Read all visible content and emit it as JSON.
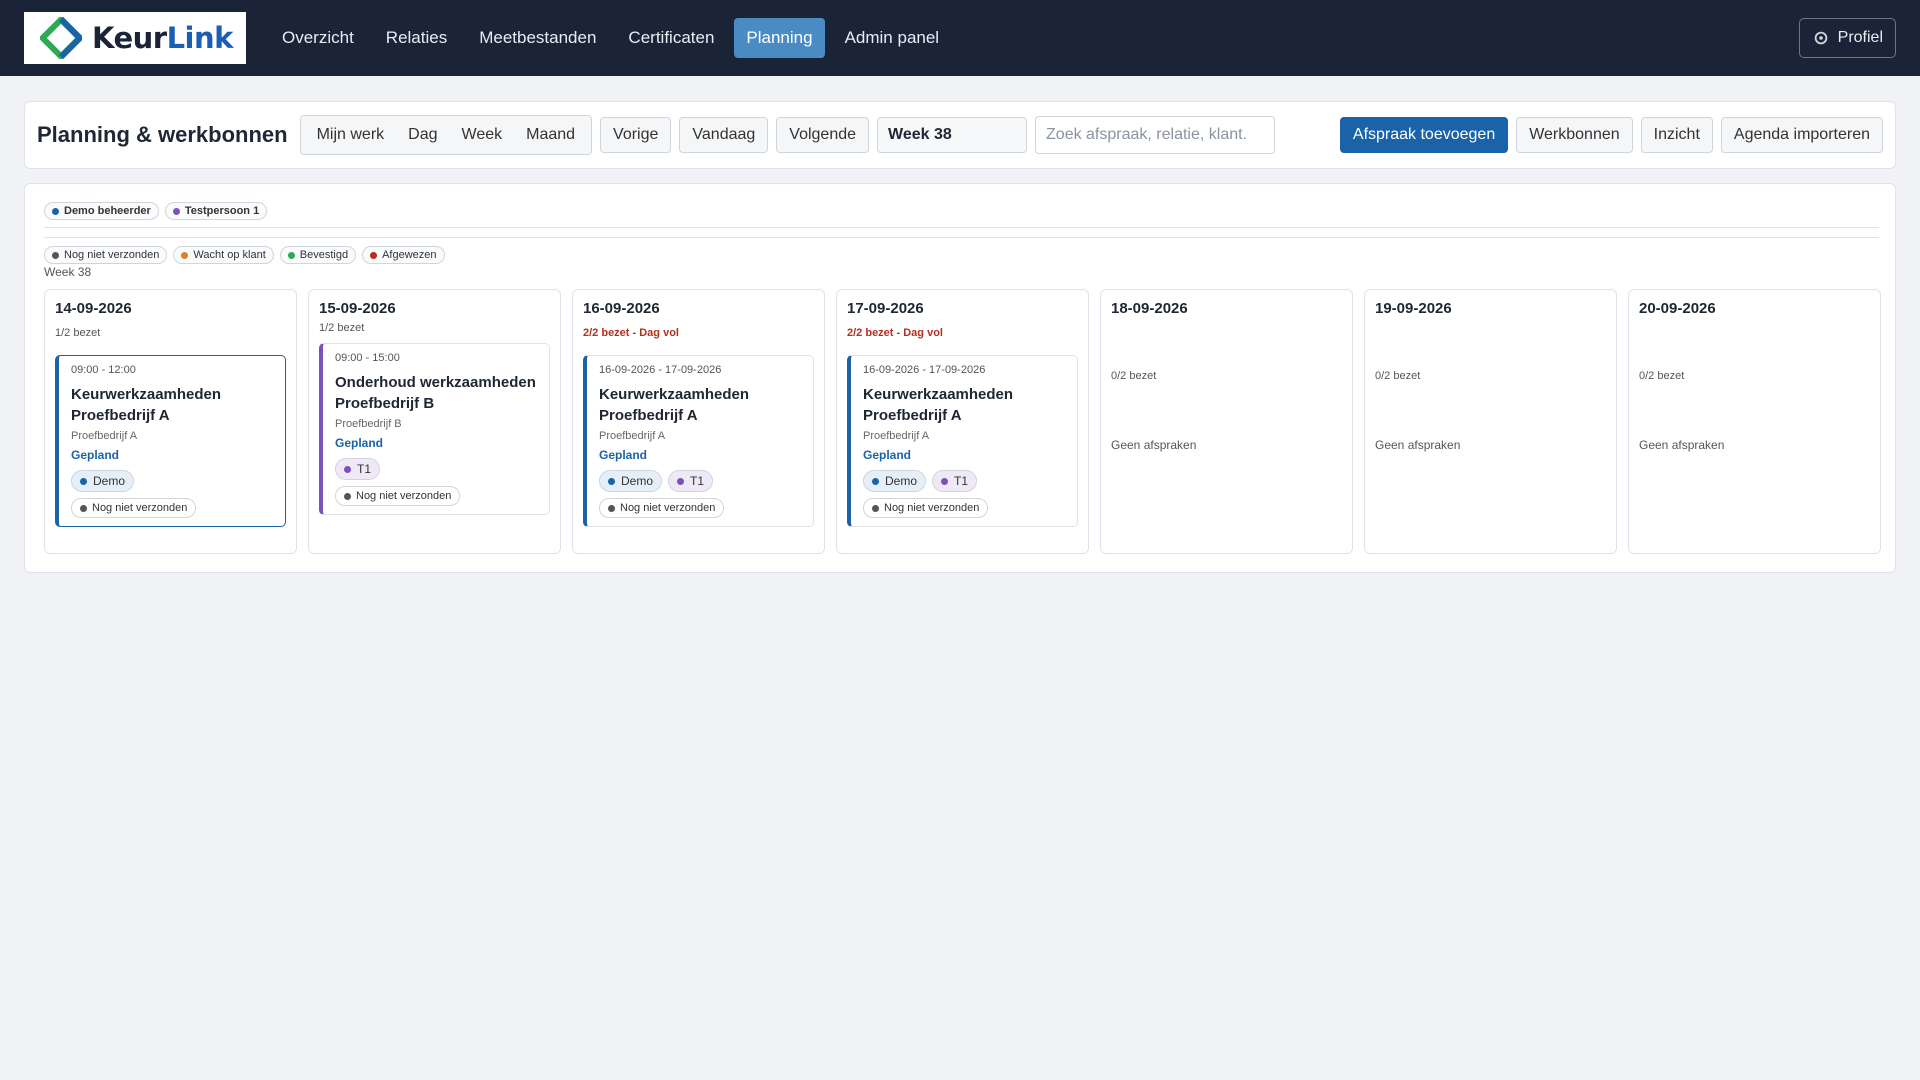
{
  "brand": {
    "name_part1": "Keur",
    "name_part2": "Link"
  },
  "nav": [
    {
      "label": "Overzicht",
      "active": false
    },
    {
      "label": "Relaties",
      "active": false
    },
    {
      "label": "Meetbestanden",
      "active": false
    },
    {
      "label": "Certificaten",
      "active": false
    },
    {
      "label": "Planning",
      "active": true
    },
    {
      "label": "Admin panel",
      "active": false
    }
  ],
  "profile": {
    "label": "Profiel",
    "icon": "gear-icon"
  },
  "toolbar": {
    "title": "Planning & werkbonnen",
    "views": [
      "Mijn werk",
      "Dag",
      "Week",
      "Maand"
    ],
    "prev": "Vorige",
    "today": "Vandaag",
    "next": "Volgende",
    "week_value": "Week 38",
    "search_placeholder": "Zoek afspraak, relatie, klant.",
    "add": "Afspraak toevoegen",
    "workorders": "Werkbonnen",
    "insight": "Inzicht",
    "import": "Agenda importeren"
  },
  "people": [
    {
      "label": "Demo beheerder",
      "color": "#1a63a8"
    },
    {
      "label": "Testpersoon 1",
      "color": "#7b52b9"
    }
  ],
  "statuses": [
    {
      "label": "Nog niet verzonden",
      "color": "#555555"
    },
    {
      "label": "Wacht op klant",
      "color": "#d9822b"
    },
    {
      "label": "Bevestigd",
      "color": "#2eaa55"
    },
    {
      "label": "Afgewezen",
      "color": "#c0281e"
    }
  ],
  "week_label": "Week 38",
  "days": [
    {
      "date": "14-09-2026",
      "capacity": "1/2 bezet",
      "appt": {
        "time": "09:00 - 12:00",
        "name": "Keurwerkzaamheden Proefbedrijf A",
        "client": "Proefbedrijf A",
        "state": "Gepland",
        "tags": [
          "Demo"
        ],
        "send": "Nog niet verzonden"
      }
    },
    {
      "date": "15-09-2026",
      "capacity": "1/2 bezet",
      "appt": {
        "time": "09:00 - 15:00",
        "name": "Onderhoud werkzaamheden Proefbedrijf B",
        "client": "Proefbedrijf B",
        "state": "Gepland",
        "tags": [
          "T1"
        ],
        "send": "Nog niet verzonden"
      }
    },
    {
      "date": "16-09-2026",
      "capacity": "2/2 bezet - Dag vol",
      "appt": {
        "time": "16-09-2026 - 17-09-2026",
        "name": "Keurwerkzaamheden Proefbedrijf A",
        "client": "Proefbedrijf A",
        "state": "Gepland",
        "tags": [
          "Demo",
          "T1"
        ],
        "send": "Nog niet verzonden"
      }
    },
    {
      "date": "17-09-2026",
      "capacity": "2/2 bezet - Dag vol",
      "appt": {
        "time": "16-09-2026 - 17-09-2026",
        "name": "Keurwerkzaamheden Proefbedrijf A",
        "client": "Proefbedrijf A",
        "state": "Gepland",
        "tags": [
          "Demo",
          "T1"
        ],
        "send": "Nog niet verzonden"
      }
    },
    {
      "date": "18-09-2026",
      "capacity": "0/2 bezet",
      "empty": "Geen afspraken"
    },
    {
      "date": "19-09-2026",
      "capacity": "0/2 bezet",
      "empty": "Geen afspraken"
    },
    {
      "date": "20-09-2026",
      "capacity": "0/2 bezet",
      "empty": "Geen afspraken"
    }
  ]
}
